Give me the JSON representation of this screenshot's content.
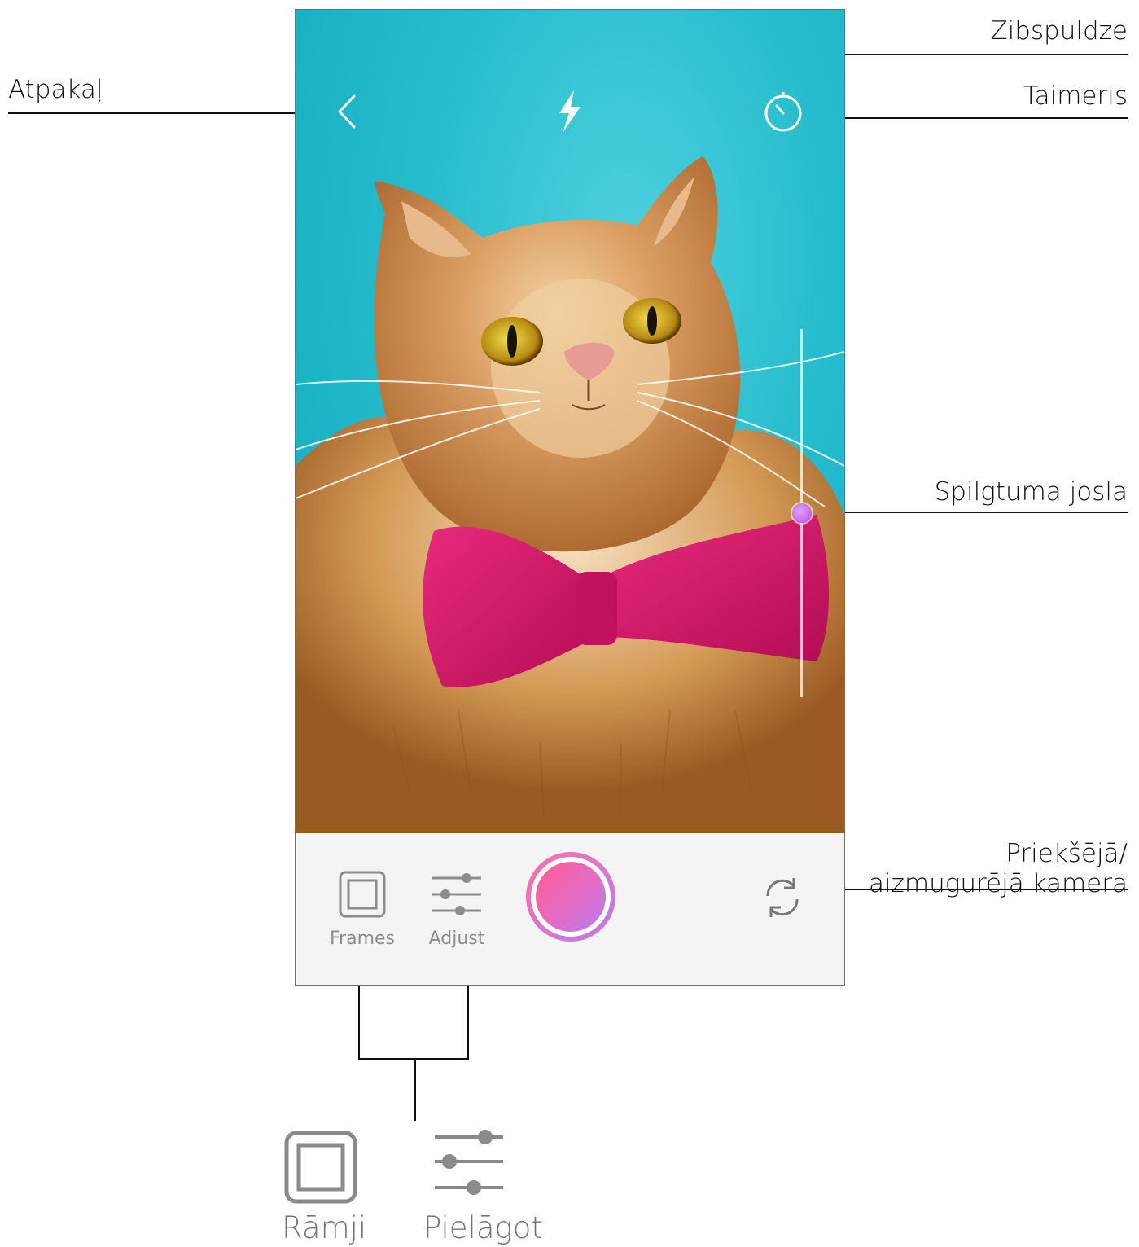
{
  "callouts": {
    "back": "Atpakaļ",
    "flash": "Zibspuldze",
    "timer": "Taimeris",
    "brightness_bar": "Spilgtuma josla",
    "camera_switch_line1": "Priekšējā/",
    "camera_switch_line2": "aizmugurējā kamera"
  },
  "camera_screen": {
    "icons": {
      "back": "chevron-left-icon",
      "flash": "flash-icon",
      "timer": "timer-icon",
      "switch_camera": "switch-camera-icon",
      "frames": "frames-icon",
      "adjust": "sliders-icon"
    },
    "brightness_level": 0.5,
    "toolbar": {
      "frames_label": "Frames",
      "adjust_label": "Adjust"
    },
    "shutter_gradient": [
      "#ff6fa8",
      "#b57df0"
    ]
  },
  "legend": {
    "frames_label": "Rāmji",
    "adjust_label": "Pielāgot"
  },
  "colors": {
    "background_teal": "#1fb7cc",
    "bowtie": "#d4156a",
    "cat_fur": "#d9964a",
    "toolbar_bg": "#f4f4f4",
    "icon_gray": "#8c8c8c"
  }
}
